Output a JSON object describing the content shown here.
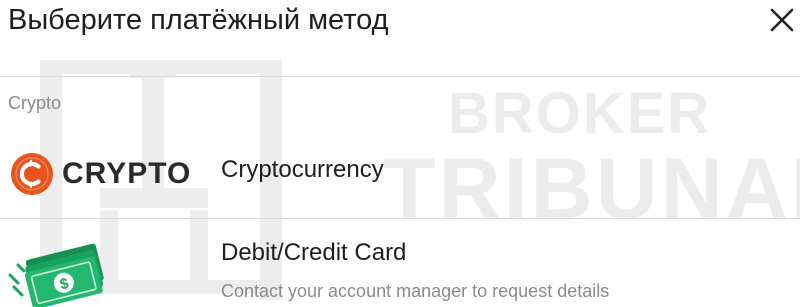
{
  "header": {
    "title": "Выберите платёжный метод",
    "close_icon": "close-icon"
  },
  "watermark": {
    "line1": "BROKER",
    "line2": "TRIBUNAL"
  },
  "section": {
    "label": "Crypto"
  },
  "methods": [
    {
      "name": "Cryptocurrency",
      "logo_text": "CRYPTO",
      "icon": "crypto-coin-icon",
      "accent": "#e8541e"
    },
    {
      "name": "Debit/Credit Card",
      "description": "Contact your account manager to request details",
      "icon": "cash-banknote-icon",
      "accent": "#1aa260"
    }
  ]
}
